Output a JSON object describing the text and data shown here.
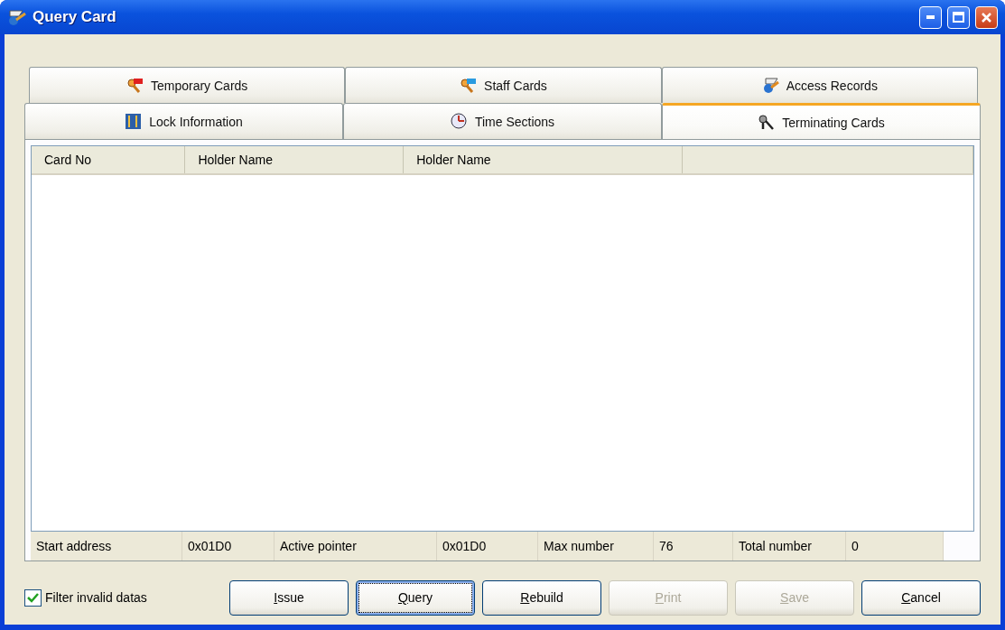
{
  "window": {
    "title": "Query Card"
  },
  "tab_rows": [
    [
      {
        "label": "Temporary Cards",
        "selected": false
      },
      {
        "label": "Staff Cards",
        "selected": false
      },
      {
        "label": "Access Records",
        "selected": false
      }
    ],
    [
      {
        "label": "Lock Information",
        "selected": false
      },
      {
        "label": "Time Sections",
        "selected": false
      },
      {
        "label": "Terminating Cards",
        "selected": true
      }
    ]
  ],
  "table": {
    "columns": [
      "Card No",
      "Holder Name",
      "Holder Name"
    ]
  },
  "status_bar": [
    "Start address",
    "0x01D0",
    "Active pointer",
    "0x01D0",
    "Max number",
    "76",
    "Total number",
    "0"
  ],
  "filter": {
    "label": "Filter invalid datas",
    "checked": true
  },
  "buttons": [
    {
      "label": "Issue",
      "disabled": false,
      "focused": false
    },
    {
      "label": "Query",
      "disabled": false,
      "focused": true
    },
    {
      "label": "Rebuild",
      "disabled": false,
      "focused": false
    },
    {
      "label": "Print",
      "disabled": true,
      "focused": false
    },
    {
      "label": "Save",
      "disabled": true,
      "focused": false
    },
    {
      "label": "Cancel",
      "disabled": false,
      "focused": false
    }
  ]
}
